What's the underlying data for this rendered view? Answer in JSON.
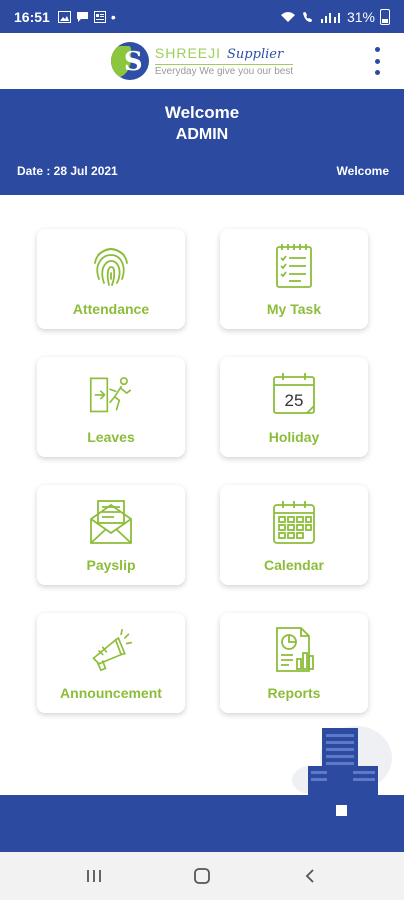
{
  "status_bar": {
    "time": "16:51",
    "battery": "31%",
    "icons": [
      "image-icon",
      "chat-icon",
      "news-icon",
      "dot-icon",
      "wifi-icon",
      "volte-icon",
      "signal-icon",
      "battery-icon"
    ]
  },
  "header": {
    "brand": "SHREEJI",
    "brand_suffix": "Supplier",
    "tagline": "Everyday We give you our best"
  },
  "banner": {
    "welcome_line1": "Welcome",
    "welcome_line2": "ADMIN",
    "date_text": "Date : 28 Jul 2021",
    "welcome_right": "Welcome"
  },
  "tiles": [
    {
      "label": "Attendance",
      "icon": "fingerprint-icon"
    },
    {
      "label": "My Task",
      "icon": "checklist-icon"
    },
    {
      "label": "Leaves",
      "icon": "exit-icon"
    },
    {
      "label": "Holiday",
      "icon": "calendar-date-icon",
      "icon_text": "25"
    },
    {
      "label": "Payslip",
      "icon": "envelope-icon"
    },
    {
      "label": "Calendar",
      "icon": "calendar-icon"
    },
    {
      "label": "Announcement",
      "icon": "megaphone-icon"
    },
    {
      "label": "Reports",
      "icon": "report-chart-icon"
    }
  ],
  "colors": {
    "primary": "#2b4aa0",
    "accent_green": "#8cbd3a",
    "tile_bg": "#ffffff"
  },
  "nav": {
    "buttons": [
      "recent-apps",
      "home",
      "back"
    ]
  }
}
